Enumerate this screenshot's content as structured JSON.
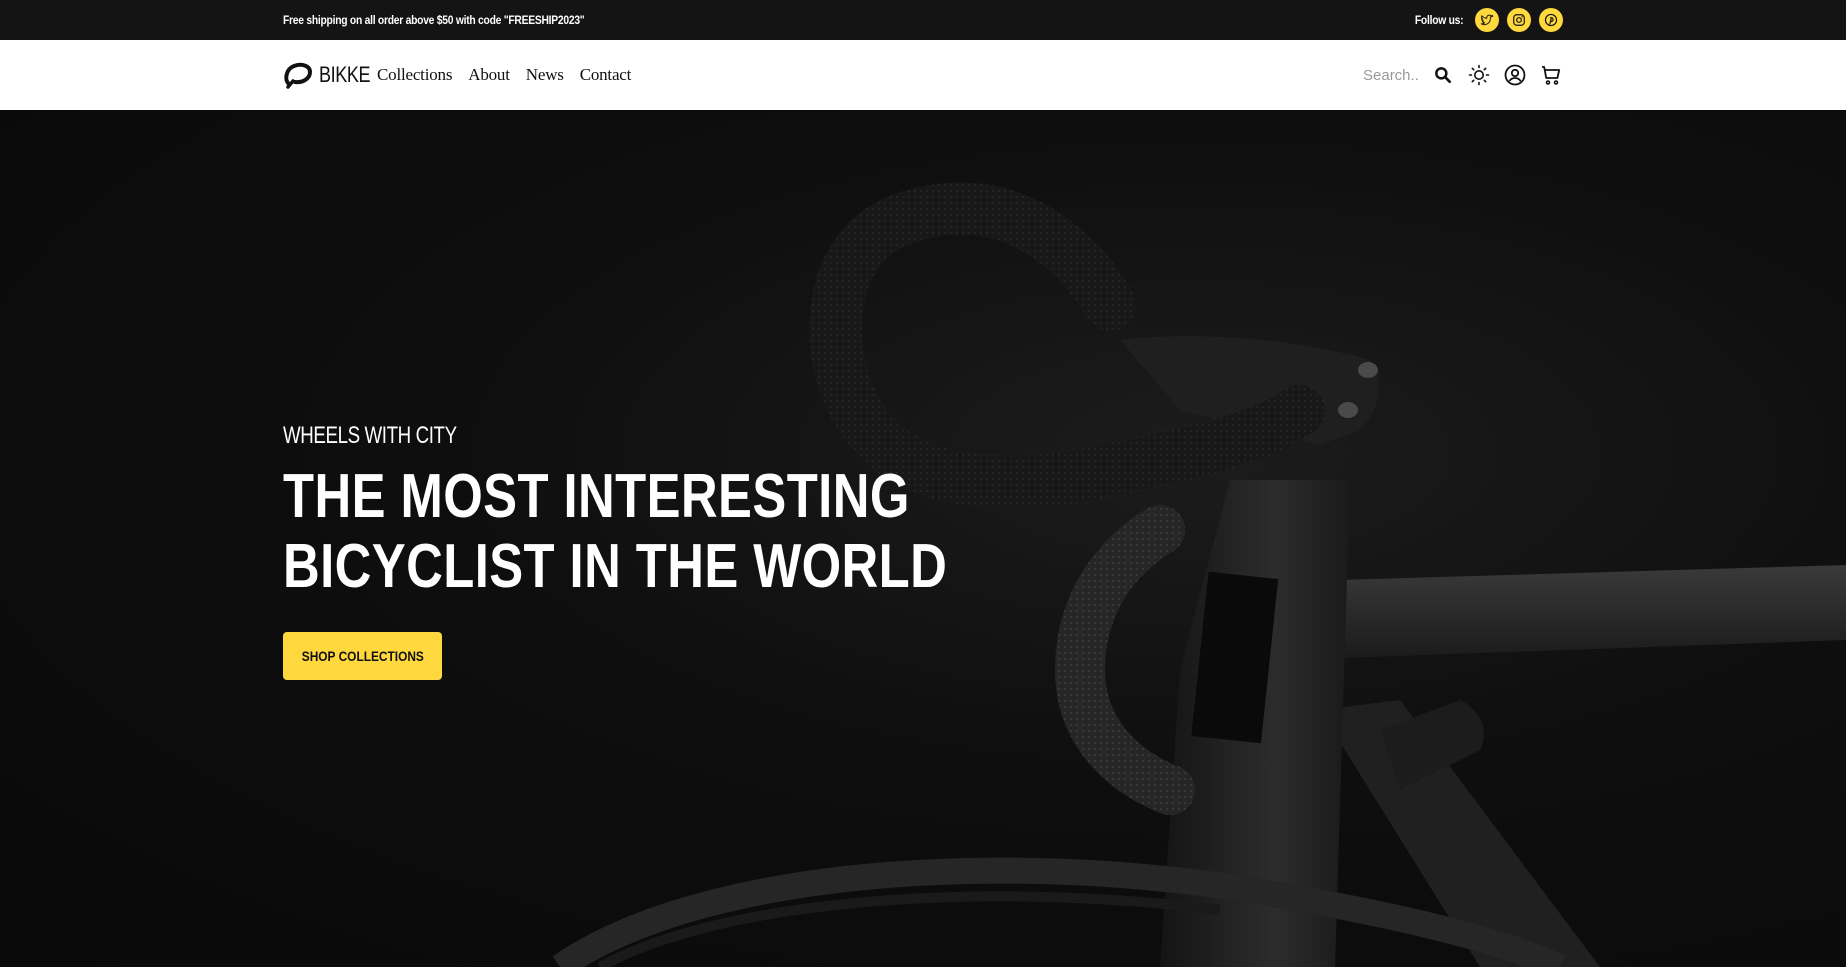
{
  "topbar": {
    "promo": "Free shipping on all order above $50 with code \"FREESHIP2023\"",
    "follow_label": "Follow us:",
    "socials": [
      "twitter-icon",
      "instagram-icon",
      "pinterest-icon"
    ],
    "accent": "#ffd83d"
  },
  "nav": {
    "brand": "BIKKE",
    "menu": [
      "Collections",
      "About",
      "News",
      "Contact"
    ],
    "search_placeholder": "Search...",
    "icons": [
      "search-icon",
      "sun-icon",
      "user-icon",
      "cart-icon"
    ]
  },
  "hero": {
    "eyebrow": "WHEELS WITH CITY",
    "headline_line1": "THE MOST INTERESTING",
    "headline_line2": "BICYCLIST IN THE WORLD",
    "cta": "SHOP COLLECTIONS",
    "background": "#0b0b0b"
  }
}
